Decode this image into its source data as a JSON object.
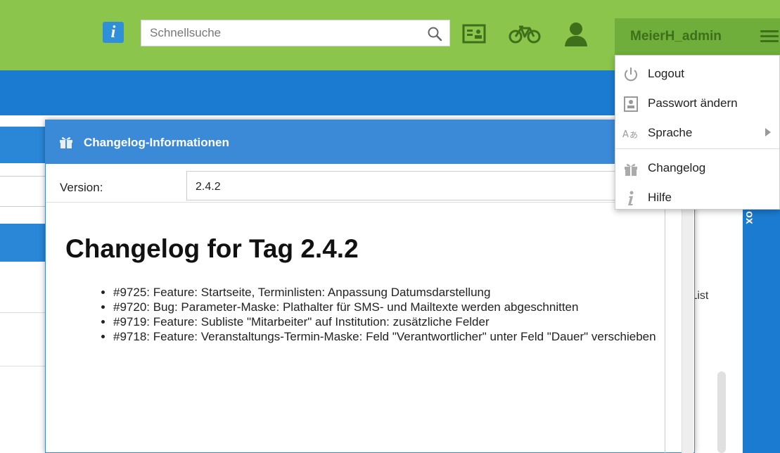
{
  "header": {
    "info_icon": "info-icon",
    "search_placeholder": "Schnellsuche",
    "user_name": "MeierH_admin"
  },
  "menu": {
    "items": [
      {
        "label": "Logout",
        "icon": "power-icon"
      },
      {
        "label": "Passwort ändern",
        "icon": "id-card-icon"
      },
      {
        "label": "Sprache",
        "icon": "translate-icon"
      },
      {
        "label": "Changelog",
        "icon": "gift-icon"
      },
      {
        "label": "Hilfe",
        "icon": "info-icon"
      }
    ]
  },
  "modal": {
    "title": "Changelog-Informationen",
    "version_label": "Version:",
    "version_value": "2.4.2",
    "heading": "Changelog for Tag 2.4.2",
    "entries": [
      "#9725: Feature: Startseite, Terminlisten: Anpassung Datumsdarstellung",
      "#9720: Bug: Parameter-Maske: Plathalter für SMS- und Mailtexte werden abgeschnitten",
      "#9719: Feature: Subliste \"Mitarbeiter\" auf Institution: zusätzliche Felder",
      "#9718: Feature: Veranstaltungs-Termin-Maske: Feld \"Verantwortlicher\" unter Feld \"Dauer\" verschieben"
    ]
  },
  "background": {
    "list_label": ".List",
    "side_tab_label": "ox"
  },
  "colors": {
    "header_green": "#8cc54b",
    "user_area_green": "#6fae3a",
    "primary_blue": "#1a7bd0",
    "modal_blue": "#3b8ad8"
  }
}
